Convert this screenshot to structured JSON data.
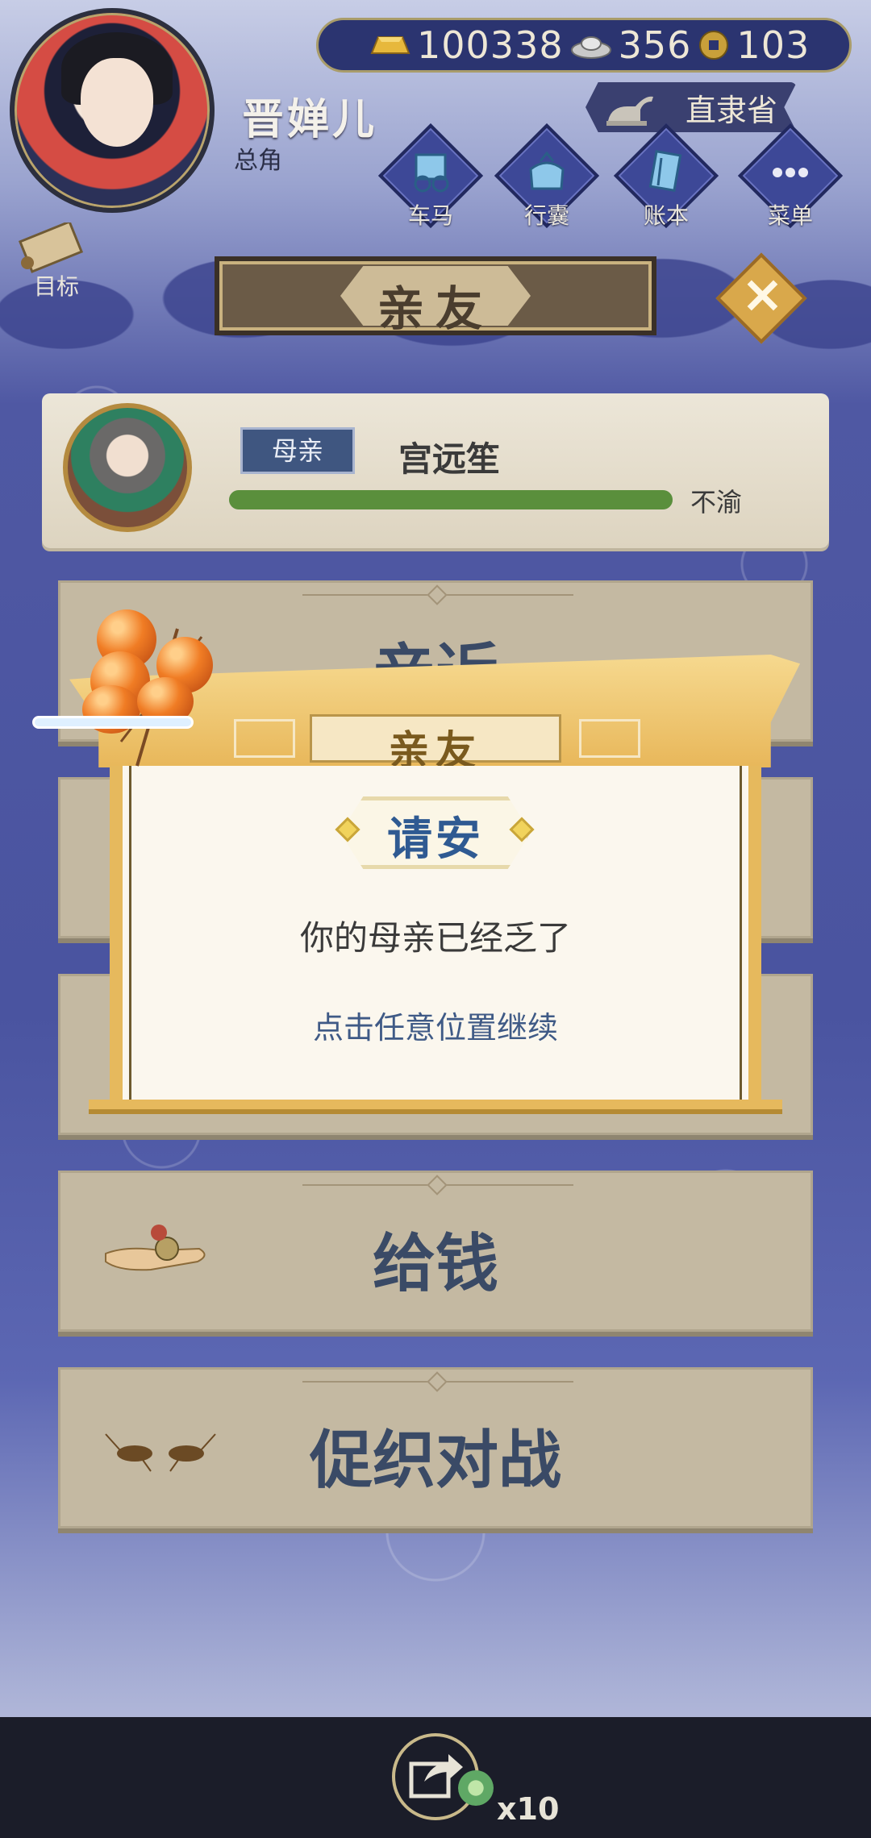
{
  "player": {
    "name": "晋婵儿",
    "role": "总角"
  },
  "currency": {
    "gold": "100338",
    "silver": "356",
    "coin": "103"
  },
  "location": "直隶省",
  "nav": [
    {
      "label": "车马",
      "icon": "carriage-icon"
    },
    {
      "label": "行囊",
      "icon": "bag-icon"
    },
    {
      "label": "账本",
      "icon": "ledger-icon"
    },
    {
      "label": "菜单",
      "icon": "menu-icon"
    }
  ],
  "goal_label": "目标",
  "page_title": "亲友",
  "relative": {
    "relation": "母亲",
    "name": "宫远笙",
    "status": "不渝",
    "affection_fraction": 1.0
  },
  "actions": [
    {
      "label": "亲近",
      "icon": "closeness-icon"
    },
    {
      "label": "给钱",
      "icon": "give-money-icon"
    },
    {
      "label": "促织对战",
      "icon": "cricket-icon"
    }
  ],
  "modal": {
    "title": "亲友",
    "subtitle": "请安",
    "message": "你的母亲已经乏了",
    "hint": "点击任意位置继续"
  },
  "share": {
    "count": "x10"
  },
  "colors": {
    "accent_gold": "#e6b95d",
    "bar_green": "#5a8f3c",
    "title_blue": "#2f5a92"
  }
}
